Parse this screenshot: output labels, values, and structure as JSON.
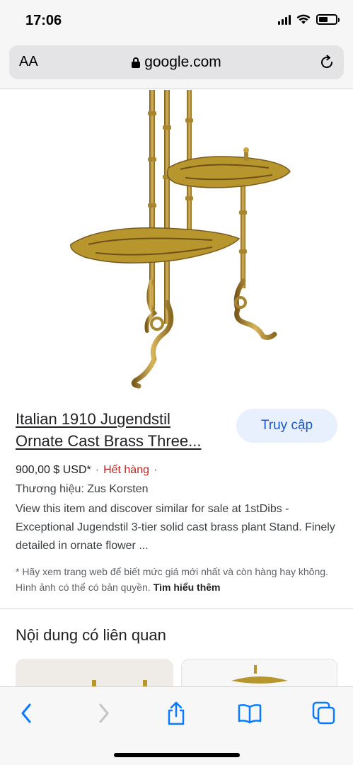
{
  "status_bar": {
    "time": "17:06"
  },
  "address_bar": {
    "aa_label": "AA",
    "url": "google.com"
  },
  "product": {
    "title_line1": "Italian 1910 Jugendstil",
    "title_line2": "Ornate Cast Brass Three...",
    "visit_button": "Truy cập",
    "price": "900,00 $ USD*",
    "separator": "·",
    "stock_status": "Hết hàng",
    "brand": "Thương hiệu: Zus Korsten",
    "description": "View this item and discover similar for sale at 1stDibs - Exceptional Jugendstil 3-tier solid cast brass plant Stand. Finely detailed in ornate flower ...",
    "disclaimer": "* Hãy xem trang web để biết mức giá mới nhất và còn hàng hay không. Hình ảnh có thể có bản quyền.",
    "learn_more": "Tìm hiểu thêm"
  },
  "related": {
    "heading": "Nội dung có liên quan"
  },
  "toolbar": {
    "icons": [
      "back-icon",
      "forward-icon",
      "share-icon",
      "bookmarks-icon",
      "tabs-icon"
    ]
  },
  "colors": {
    "visit_bg": "#e8f0fe",
    "visit_text": "#1a57c9",
    "out_of_stock": "#c5221f",
    "ios_blue": "#0a7aff",
    "brass": "#b8962e"
  }
}
